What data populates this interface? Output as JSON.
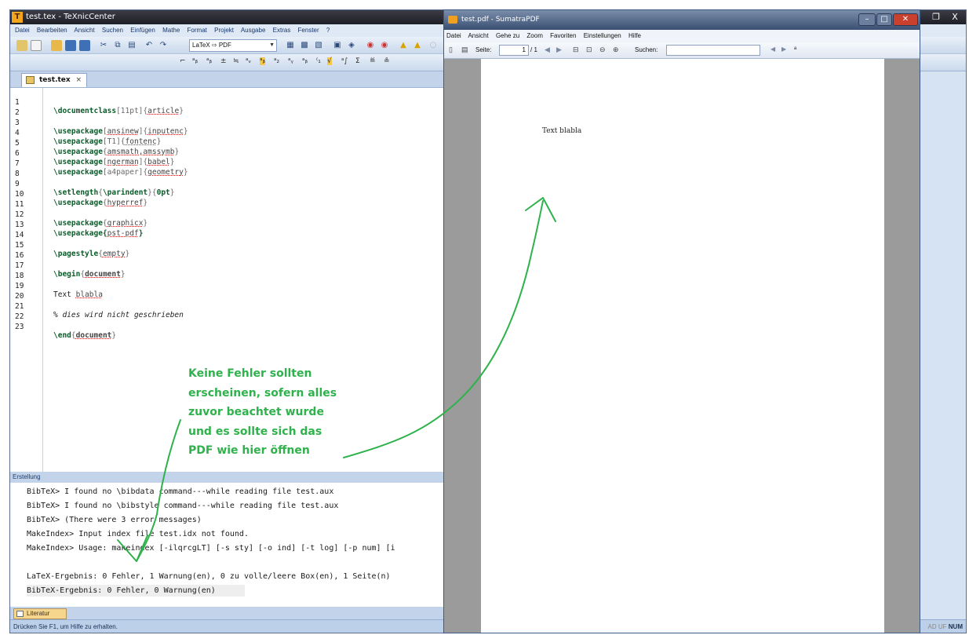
{
  "texnic": {
    "title": "test.tex - TeXnicCenter",
    "app_logo": "T",
    "menu": [
      "Datei",
      "Bearbeiten",
      "Ansicht",
      "Suchen",
      "Einfügen",
      "Mathe",
      "Format",
      "Projekt",
      "Ausgabe",
      "Extras",
      "Fenster",
      "?"
    ],
    "build_profile": "LaTeX ⇨ PDF",
    "tab_label": "test.tex",
    "tab_close": "×",
    "lines": [
      {
        "n": "1",
        "code": "\\documentclass[11pt]{article}"
      },
      {
        "n": "2",
        "code": ""
      },
      {
        "n": "3",
        "code": "\\usepackage[ansinew]{inputenc}"
      },
      {
        "n": "4",
        "code": "\\usepackage[T1]{fontenc}"
      },
      {
        "n": "5",
        "code": "\\usepackage{amsmath,amssymb}"
      },
      {
        "n": "6",
        "code": "\\usepackage[ngerman]{babel}"
      },
      {
        "n": "7",
        "code": "\\usepackage[a4paper]{geometry}"
      },
      {
        "n": "8",
        "code": ""
      },
      {
        "n": "9",
        "code": "\\setlength{\\parindent}{0pt}"
      },
      {
        "n": "10",
        "code": "\\usepackage{hyperref}"
      },
      {
        "n": "11",
        "code": ""
      },
      {
        "n": "12",
        "code": "\\usepackage{graphicx}"
      },
      {
        "n": "13",
        "code": "\\usepackage{pst-pdf}"
      },
      {
        "n": "14",
        "code": ""
      },
      {
        "n": "15",
        "code": "\\pagestyle{empty}"
      },
      {
        "n": "16",
        "code": ""
      },
      {
        "n": "17",
        "code": "\\begin{document}"
      },
      {
        "n": "18",
        "code": ""
      },
      {
        "n": "19",
        "code": "Text blabla"
      },
      {
        "n": "20",
        "code": ""
      },
      {
        "n": "21",
        "code": "% dies wird nicht geschrieben"
      },
      {
        "n": "22",
        "code": ""
      },
      {
        "n": "23",
        "code": "\\end{document}"
      }
    ],
    "build_header": "Erstellung",
    "build_header_pin": "ᵖ",
    "log": [
      "BibTeX> I found no \\bibdata command---while reading file test.aux",
      "BibTeX> I found no \\bibstyle command---while reading file test.aux",
      "BibTeX> (There were 3 error messages)",
      "MakeIndex> Input index file test.idx not found.",
      "MakeIndex> Usage: makeindex [-ilqrcgLT] [-s sty] [-o ind] [-t log] [-p num] [i",
      "",
      "LaTeX-Ergebnis: 0 Fehler, 1 Warnung(en), 0 zu volle/leere Box(en), 1 Seite(n)",
      "BibTeX-Ergebnis: 0 Fehler, 0 Warnung(en)"
    ],
    "bottom_tab": "Literatur",
    "status": "Drücken Sie F1, um Hilfe zu erhalten.",
    "status_right_dim": "AD UF",
    "status_right": "NUM"
  },
  "sumatra": {
    "title": "test.pdf - SumatraPDF",
    "menu": [
      "Datei",
      "Ansicht",
      "Gehe zu",
      "Zoom",
      "Favoriten",
      "Einstellungen",
      "Hilfe"
    ],
    "page_label": "Seite:",
    "page_value": "1",
    "page_total": "/ 1",
    "search_label": "Suchen:",
    "search_value": "",
    "pdf_text": "Text blabla"
  },
  "annotation": {
    "lines": [
      "Keine Fehler sollten",
      "erscheinen, sofern alles",
      "zuvor beachtet wurde",
      "und es sollte sich das",
      "PDF wie hier öffnen"
    ],
    "color": "#2fb24c"
  }
}
